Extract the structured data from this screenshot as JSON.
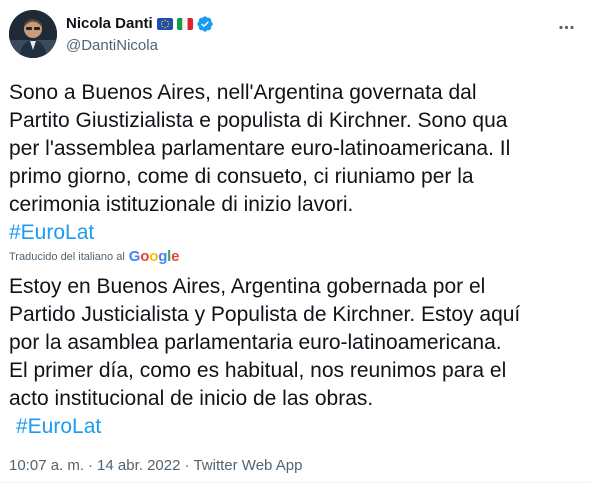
{
  "author": {
    "display_name": "Nicola Danti",
    "handle": "@DantiNicola",
    "badges": [
      "eu-flag-icon",
      "italy-flag-icon",
      "verified-badge-icon"
    ]
  },
  "tweet": {
    "lines": [
      "Sono a Buenos Aires, nell'Argentina governata dal",
      "Partito Giustizialista e populista di Kirchner. Sono qua",
      "per l'assemblea parlamentare euro-latinoamericana. Il",
      "primo giorno, come di consueto, ci riuniamo per la",
      "cerimonia istituzionale di inizio lavori."
    ],
    "hashtag": "#EuroLat"
  },
  "translation": {
    "label": "Traducido del italiano al",
    "provider": "Google",
    "lines": [
      "Estoy en Buenos Aires, Argentina gobernada por el",
      "Partido Justicialista y Populista de Kirchner. Estoy aquí",
      "por la asamblea parlamentaria euro-latinoamericana.",
      "El primer día, como es habitual, nos reunimos para el",
      "acto institucional de inicio de las obras."
    ],
    "hashtag": "#EuroLat"
  },
  "meta": {
    "time": "10:07 a. m.",
    "date": "14 abr. 2022",
    "source": "Twitter Web App",
    "separator": "·"
  },
  "colors": {
    "text": "#0f1419",
    "secondary": "#536471",
    "link": "#1d9bf0",
    "verified": "#1d9bf0"
  }
}
